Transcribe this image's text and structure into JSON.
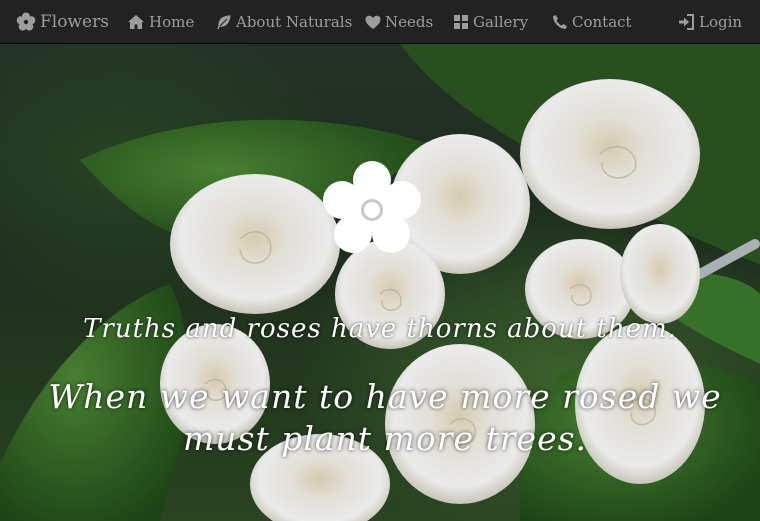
{
  "nav": {
    "brand": "Flowers",
    "items": [
      {
        "label": "Home",
        "icon": "home-icon"
      },
      {
        "label": "About Naturals",
        "icon": "leaf-icon"
      },
      {
        "label": "Needs",
        "icon": "heart-icon"
      },
      {
        "label": "Gallery",
        "icon": "grid-icon"
      },
      {
        "label": "Contact",
        "icon": "phone-icon"
      }
    ],
    "login": {
      "label": "Login",
      "icon": "login-icon"
    }
  },
  "hero": {
    "quote_small": "Truths and roses have thorns about them.",
    "quote_large": "When we want to have more rosed we must plant more trees.",
    "logo_icon": "flower-icon"
  },
  "colors": {
    "navbar_bg": "#222222",
    "nav_text": "#9d9d9d",
    "text": "#ffffff"
  }
}
